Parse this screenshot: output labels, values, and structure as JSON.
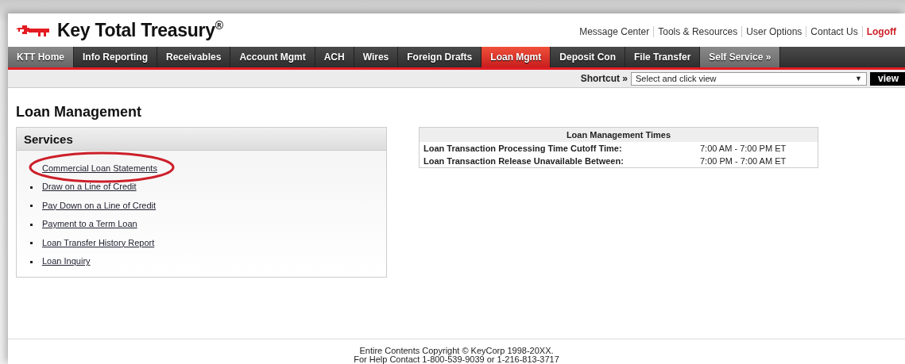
{
  "header": {
    "logo_text": "Key Total Treasury",
    "logo_mark": "®",
    "links": [
      {
        "label": "Message Center",
        "kind": "plain"
      },
      {
        "label": "Tools & Resources",
        "kind": "plain"
      },
      {
        "label": "User Options",
        "kind": "plain"
      },
      {
        "label": "Contact Us",
        "kind": "plain"
      },
      {
        "label": "Logoff",
        "kind": "alert"
      }
    ]
  },
  "tabs": [
    {
      "label": "KTT Home",
      "kind": "home",
      "selected": false
    },
    {
      "label": "Info Reporting",
      "kind": "menu",
      "selected": false
    },
    {
      "label": "Receivables",
      "kind": "menu",
      "selected": false
    },
    {
      "label": "Account Mgmt",
      "kind": "menu",
      "selected": false
    },
    {
      "label": "ACH",
      "kind": "menu",
      "selected": false
    },
    {
      "label": "Wires",
      "kind": "menu",
      "selected": false
    },
    {
      "label": "Foreign Drafts",
      "kind": "menu",
      "selected": false
    },
    {
      "label": "Loan Mgmt",
      "kind": "menu",
      "selected": true
    },
    {
      "label": "Deposit Con",
      "kind": "menu",
      "selected": false
    },
    {
      "label": "File Transfer",
      "kind": "menu",
      "selected": false
    },
    {
      "label": "Self Service »",
      "kind": "extra",
      "selected": false
    }
  ],
  "shortcut": {
    "label": "Shortcut »",
    "value": "Select and click view",
    "arrow": "▼",
    "button": "view"
  },
  "page_title": "Loan Management",
  "services": {
    "title": "Services",
    "items": [
      {
        "label": "Commercial Loan Statements",
        "highlighted": true
      },
      {
        "label": "Draw on a Line of Credit",
        "highlighted": false
      },
      {
        "label": "Pay Down on a Line of Credit",
        "highlighted": false
      },
      {
        "label": "Payment to a Term Loan",
        "highlighted": false
      },
      {
        "label": "Loan Transfer History Report",
        "highlighted": false
      },
      {
        "label": "Loan Inquiry",
        "highlighted": false
      }
    ]
  },
  "times": {
    "title": "Loan Management Times",
    "rows": [
      {
        "label": "Loan Transaction Processing Time Cutoff Time:",
        "value": "7:00 AM - 7:00 PM ET"
      },
      {
        "label": "Loan Transaction Release Unavailable Between:",
        "value": "7:00 PM - 7:00 AM ET"
      }
    ]
  },
  "footer": [
    "Entire Contents Copyright © KeyCorp 1998-20XX.",
    "For Help Contact 1-800-539-9039 or 1-216-813-3717"
  ]
}
